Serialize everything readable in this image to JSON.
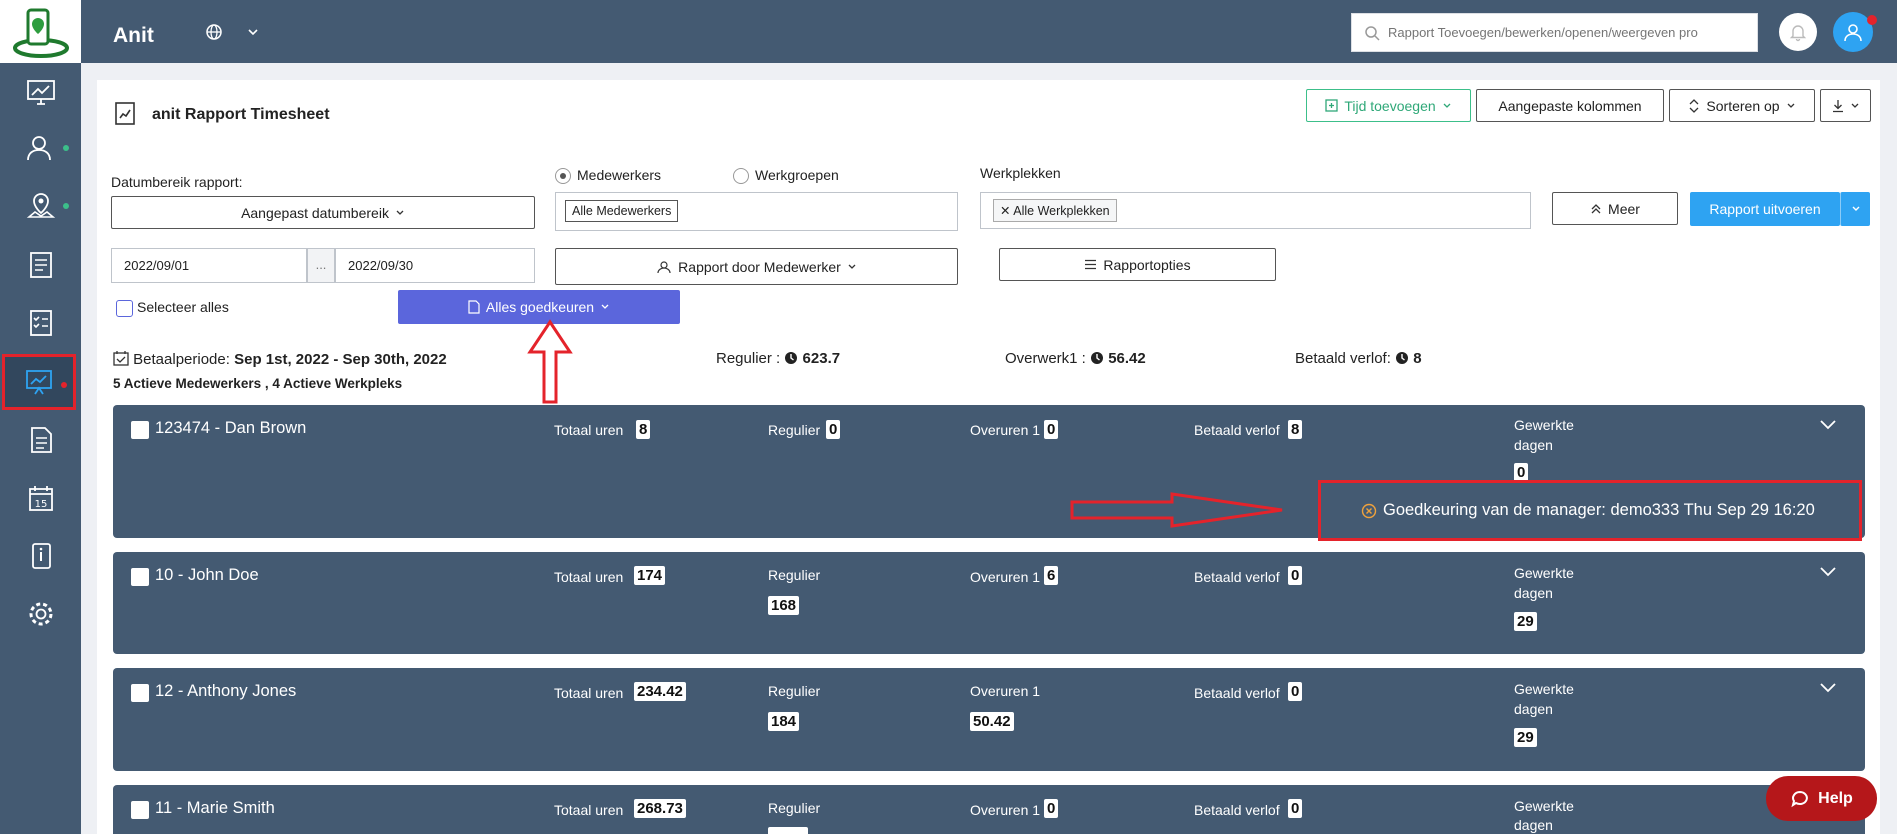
{
  "app": {
    "name": "Anit"
  },
  "search": {
    "placeholder": "Rapport Toevoegen/bewerken/openen/weergeven pro"
  },
  "report": {
    "title": "anit Rapport Timesheet"
  },
  "toolbar": {
    "add_time": "Tijd toevoegen",
    "custom_columns": "Aangepaste kolommen",
    "sort_by": "Sorteren op"
  },
  "filters": {
    "date_range_label": "Datumbereik rapport:",
    "date_range_button": "Aangepast datumbereik",
    "start_date": "2022/09/01",
    "date_separator": "...",
    "end_date": "2022/09/30",
    "radio_employees": "Medewerkers",
    "radio_workgroups": "Werkgroepen",
    "employees_chip": "Alle Medewerkers",
    "report_by_employee": "Rapport door Medewerker",
    "workplaces_label": "Werkplekken",
    "workplaces_chip": "Alle Werkplekken",
    "report_options": "Rapportopties",
    "more": "Meer",
    "run_report": "Rapport uitvoeren"
  },
  "bulk": {
    "select_all": "Selecteer alles",
    "approve_all": "Alles goedkeuren"
  },
  "summary": {
    "pay_period_label": "Betaalperiode:",
    "pay_period_value": "Sep 1st, 2022 - Sep 30th, 2022",
    "regular_label": "Regulier :",
    "regular_value": "623.7",
    "overtime_label": "Overwerk1 :",
    "overtime_value": "56.42",
    "paid_leave_label": "Betaald verlof:",
    "paid_leave_value": "8",
    "active_counts": "5 Actieve Medewerkers , 4 Actieve Werkpleks"
  },
  "labels": {
    "total_hours": "Totaal uren",
    "regular": "Regulier",
    "overtime": "Overuren 1",
    "paid_leave": "Betaald verlof",
    "worked_days_1": "Gewerkte",
    "worked_days_2": "dagen"
  },
  "employees": [
    {
      "name": "123474 - Dan Brown",
      "total": "8",
      "regular": "0",
      "overtime": "0",
      "paid_leave": "8",
      "days": "0",
      "approval": "Goedkeuring van de manager: demo333 Thu Sep 29 16:20"
    },
    {
      "name": "10 - John Doe",
      "total": "174",
      "regular": "168",
      "overtime": "6",
      "paid_leave": "0",
      "days": "29"
    },
    {
      "name": "12 - Anthony Jones",
      "total": "234.42",
      "regular": "184",
      "overtime": "50.42",
      "paid_leave": "0",
      "days": "29"
    },
    {
      "name": "11 - Marie Smith",
      "total": "268.73",
      "regular": "",
      "overtime": "0",
      "paid_leave": "0",
      "days": ""
    }
  ],
  "help": {
    "label": "Help"
  },
  "colors": {
    "sidebar": "#445a72",
    "accent_blue": "#2ea3f2",
    "approve_button": "#5b66dc",
    "annotation_red": "#e4232b"
  }
}
